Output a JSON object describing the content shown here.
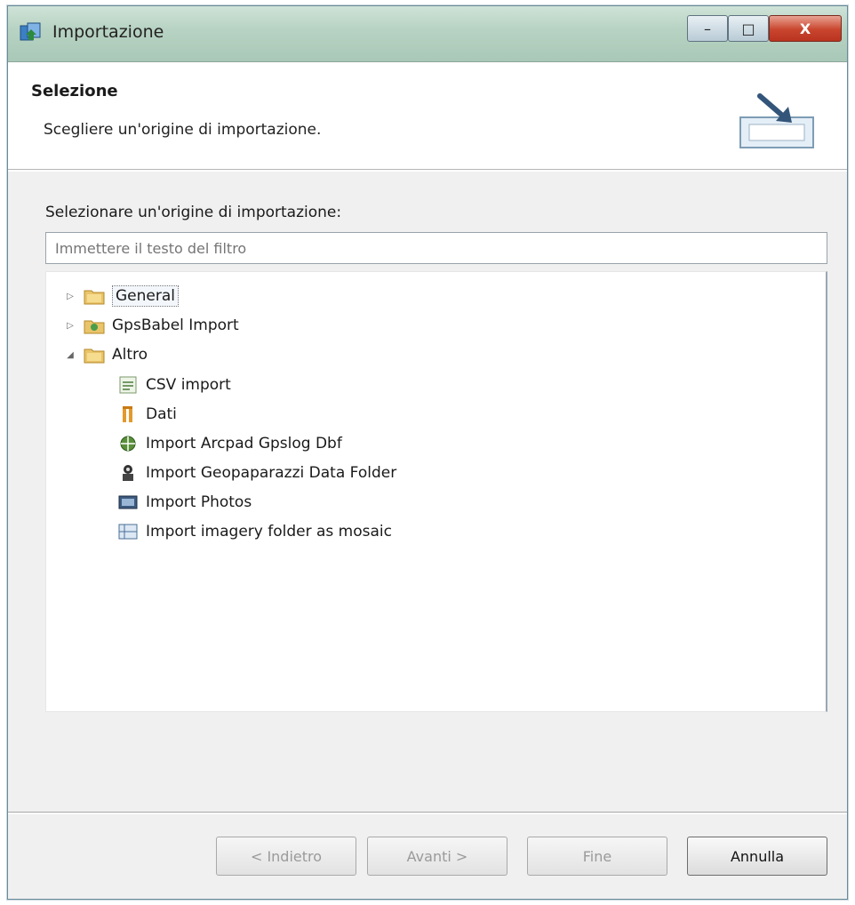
{
  "window": {
    "title": "Importazione",
    "minimize_label": "–",
    "maximize_label": "□",
    "close_label": "X"
  },
  "banner": {
    "title": "Selezione",
    "subtitle": "Scegliere un'origine di importazione."
  },
  "main": {
    "select_label": "Selezionare un'origine di importazione:",
    "filter_placeholder": "Immettere il testo del filtro"
  },
  "tree": {
    "items": [
      {
        "label": "General",
        "expander": "▷",
        "icon": "folder-icon",
        "selected": true
      },
      {
        "label": "GpsBabel Import",
        "expander": "▷",
        "icon": "gpsbabel-icon"
      },
      {
        "label": "Altro",
        "expander": "◢",
        "icon": "folder-icon"
      },
      {
        "label": "CSV import",
        "icon": "csv-icon"
      },
      {
        "label": "Dati",
        "icon": "data-icon"
      },
      {
        "label": "Import Arcpad Gpslog Dbf",
        "icon": "arcpad-icon"
      },
      {
        "label": "Import Geopaparazzi Data Folder",
        "icon": "geopaparazzi-icon"
      },
      {
        "label": "Import Photos",
        "icon": "photos-icon"
      },
      {
        "label": "Import imagery folder as mosaic",
        "icon": "mosaic-icon"
      }
    ]
  },
  "buttons": {
    "back": "< Indietro",
    "next": "Avanti >",
    "finish": "Fine",
    "cancel": "Annulla"
  },
  "colors": {
    "titlebar": "#b8d3c3",
    "close": "#c9452d",
    "dialog_bg": "#f0f0f0"
  }
}
